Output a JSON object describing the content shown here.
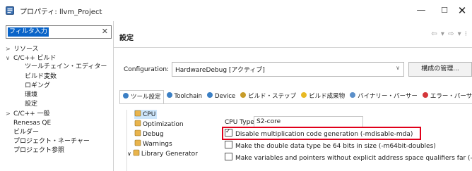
{
  "window": {
    "title": "プロパティ: llvm_Project",
    "icon": "properties-app-icon",
    "controls": [
      "minimize-icon",
      "maximize-icon",
      "close-icon"
    ]
  },
  "left_panel": {
    "filter_placeholder": "フィルタ入力",
    "filter_clear": "✕",
    "tree": [
      {
        "label": "リソース",
        "twisty": ">",
        "indent": 0
      },
      {
        "label": "C/C++ ビルド",
        "twisty": "∨",
        "indent": 0
      },
      {
        "label": "ツールチェイン・エディター",
        "twisty": "",
        "indent": 2
      },
      {
        "label": "ビルド変数",
        "twisty": "",
        "indent": 2
      },
      {
        "label": "ロギング",
        "twisty": "",
        "indent": 2
      },
      {
        "label": "環境",
        "twisty": "",
        "indent": 2
      },
      {
        "label": "設定",
        "twisty": "",
        "indent": 2,
        "selected": true
      },
      {
        "label": "C/C++ 一般",
        "twisty": ">",
        "indent": 0
      },
      {
        "label": "Renesas QE",
        "twisty": "",
        "indent": 0
      },
      {
        "label": "ビルダー",
        "twisty": "",
        "indent": 0
      },
      {
        "label": "プロジェクト・ネーチャー",
        "twisty": "",
        "indent": 0
      },
      {
        "label": "プロジェクト参照",
        "twisty": "",
        "indent": 0
      }
    ]
  },
  "right_panel": {
    "title": "設定",
    "nav_icons": "⇦ ▾ ⇨ ▾ ⁝",
    "configuration_label": "Configuration:",
    "configuration_value": "HardwareDebug [アクティブ]",
    "configuration_arrow": "∨",
    "manage_button": "構成の管理...",
    "tabs": [
      {
        "label": "ツール設定",
        "icon": "tool-settings-icon",
        "active": true
      },
      {
        "label": "Toolchain",
        "icon": "toolchain-icon"
      },
      {
        "label": "Device",
        "icon": "device-icon"
      },
      {
        "label": "ビルド・ステップ",
        "icon": "build-steps-icon"
      },
      {
        "label": "ビルド成果物",
        "icon": "build-artifact-icon"
      },
      {
        "label": "バイナリー・パーサー",
        "icon": "binary-parser-icon"
      },
      {
        "label": "エラー・パーサー",
        "icon": "error-parser-icon"
      }
    ],
    "settings_tree": [
      {
        "label": "CPU",
        "selected": true
      },
      {
        "label": "Optimization"
      },
      {
        "label": "Debug"
      },
      {
        "label": "Warnings"
      },
      {
        "label": "Library Generator",
        "twisty": "∨"
      }
    ],
    "cpu_type_label": "CPU Type",
    "cpu_type_value": "S2-core",
    "options": [
      {
        "label": "Disable multiplication code generation (-mdisable-mda)",
        "checked": true
      },
      {
        "label": "Make the double data type be 64 bits in size (-m64bit-doubles)",
        "checked": false
      },
      {
        "label": "Make variables and pointers without explicit address space qualifiers far (-mf",
        "checked": false
      }
    ]
  },
  "colors": {
    "selection": "#0a64c8",
    "highlight_box": "#e0001a",
    "tree_selection": "#cde6fb"
  }
}
